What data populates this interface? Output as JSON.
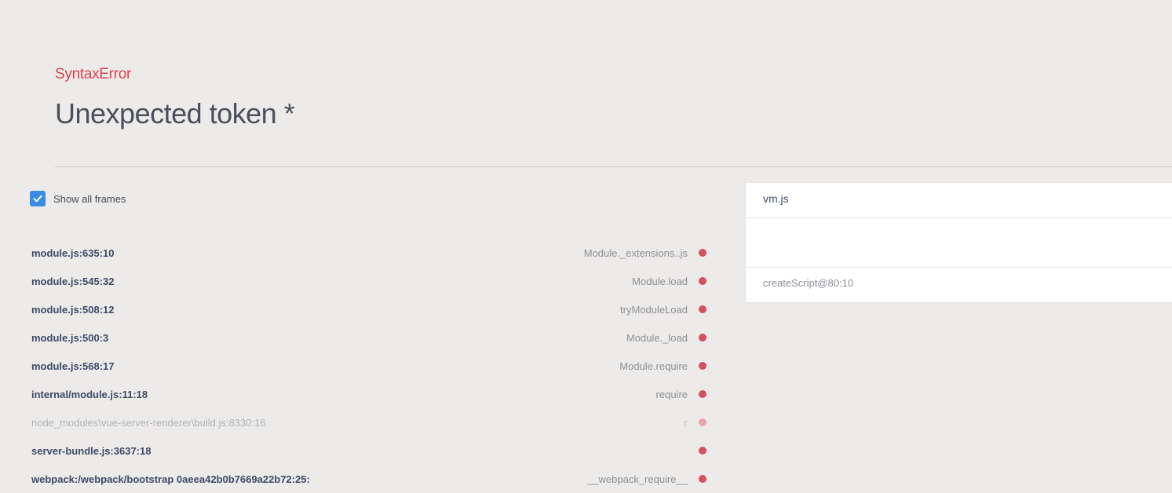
{
  "error": {
    "name": "SyntaxError",
    "message": "Unexpected token *"
  },
  "show_all_frames": {
    "label": "Show all frames",
    "checked": true
  },
  "frames": [
    {
      "file": "module.js:635:10",
      "function": "Module._extensions..js",
      "faded": false
    },
    {
      "file": "module.js:545:32",
      "function": "Module.load",
      "faded": false
    },
    {
      "file": "module.js:508:12",
      "function": "tryModuleLoad",
      "faded": false
    },
    {
      "file": "module.js:500:3",
      "function": "Module._load",
      "faded": false
    },
    {
      "file": "module.js:568:17",
      "function": "Module.require",
      "faded": false
    },
    {
      "file": "internal/module.js:11:18",
      "function": "require",
      "faded": false
    },
    {
      "file": "node_modules\\vue-server-renderer\\build.js:8330:16",
      "function": "r",
      "faded": true
    },
    {
      "file": "server-bundle.js:3637:18",
      "function": "",
      "faded": false
    },
    {
      "file": "webpack:/webpack/bootstrap 0aeea42b0b7669a22b72:25:",
      "function": "__webpack_require__",
      "faded": false
    }
  ],
  "code_panel": {
    "file": "vm.js",
    "location": "createScript@80:10"
  },
  "colors": {
    "background": "#edebe9",
    "error_accent": "#d9424e",
    "checkbox": "#3a8de1",
    "frame_dot": "#d3505f",
    "text_primary": "#3d4a66",
    "text_muted": "#8c8f95"
  }
}
